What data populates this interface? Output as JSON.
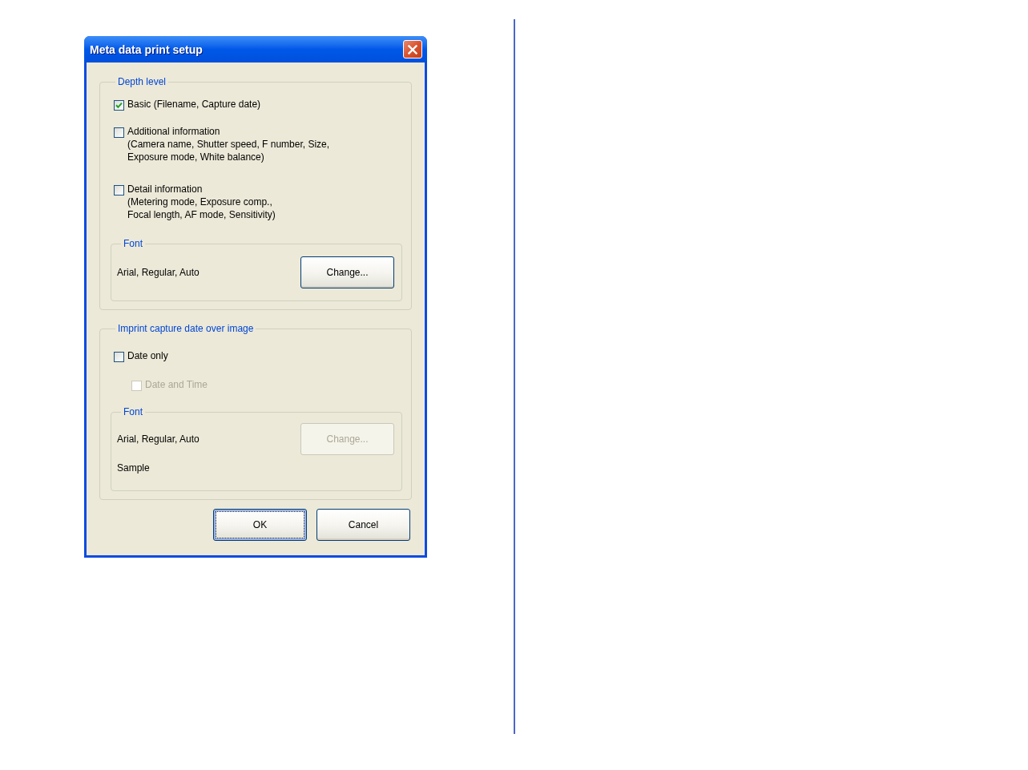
{
  "window": {
    "title": "Meta data print setup"
  },
  "depth_level": {
    "label": "Depth level",
    "options": [
      {
        "label": "Basic (Filename, Capture date)",
        "checked": true,
        "disabled": false
      },
      {
        "label": "Additional information",
        "description_lines": [
          "(Camera name, Shutter speed, F number, Size,",
          "Exposure mode, White balance)"
        ],
        "checked": false,
        "disabled": false
      },
      {
        "label": "Detail information",
        "description_lines": [
          "(Metering mode, Exposure comp.,",
          "Focal length, AF mode, Sensitivity)"
        ],
        "checked": false,
        "disabled": false
      }
    ],
    "font": {
      "label": "Font",
      "value": "Arial, Regular, Auto",
      "button": {
        "label": "Change...",
        "disabled": false
      }
    }
  },
  "imprint": {
    "label": "Imprint capture date over image",
    "options": [
      {
        "label": "Date only",
        "checked": false,
        "disabled": false,
        "children": [
          {
            "label": "Date and Time",
            "checked": false,
            "disabled": true
          }
        ]
      }
    ],
    "font": {
      "label": "Font",
      "value": "Arial, Regular, Auto",
      "sample": "Sample",
      "button": {
        "label": "Change...",
        "disabled": true
      }
    }
  },
  "buttons": [
    {
      "label": "OK",
      "default": true
    },
    {
      "label": "Cancel",
      "default": false
    }
  ]
}
